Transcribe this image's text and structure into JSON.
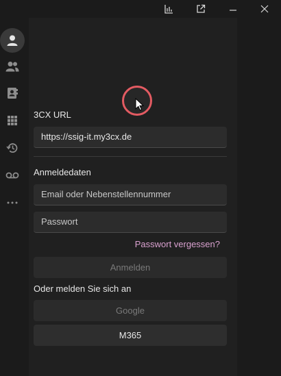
{
  "titlebar": {
    "icons": [
      "chart-icon",
      "popout-icon",
      "minimize-icon",
      "close-icon"
    ]
  },
  "sidebar": {
    "items": [
      {
        "icon": "person-icon",
        "active": true
      },
      {
        "icon": "people-icon",
        "active": false
      },
      {
        "icon": "contacts-book-icon",
        "active": false
      },
      {
        "icon": "dialpad-icon",
        "active": false
      },
      {
        "icon": "history-icon",
        "active": false
      },
      {
        "icon": "voicemail-icon",
        "active": false
      },
      {
        "icon": "more-icon",
        "active": false
      }
    ]
  },
  "login": {
    "url_label": "3CX URL",
    "url_value": "https://ssig-it.my3cx.de",
    "credentials_label": "Anmeldedaten",
    "email_placeholder": "Email oder Nebenstellennummer",
    "password_placeholder": "Passwort",
    "forgot_password": "Passwort vergessen?",
    "login_button": "Anmelden",
    "alt_login_label": "Oder melden Sie sich an",
    "google_button": "Google",
    "m365_button": "M365"
  },
  "colors": {
    "background": "#1b1b1b",
    "panel": "#202020",
    "field": "#2c2c2c",
    "link": "#d9a1cf",
    "cursor_ring": "#e35b62"
  }
}
